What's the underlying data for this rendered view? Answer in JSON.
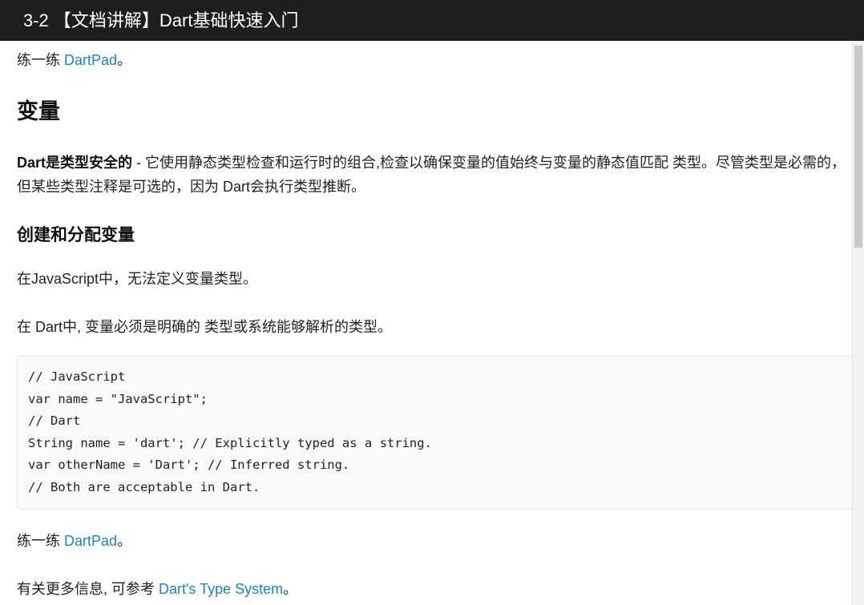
{
  "window": {
    "title": "3-2 【文档讲解】Dart基础快速入门"
  },
  "content": {
    "try_prefix": "练一练 ",
    "try_link": "DartPad",
    "try_suffix": "。",
    "h_variables": "变量",
    "type_safe_bold": "Dart是类型安全的",
    "type_safe_rest": " - 它使用静态类型检查和运行时的组合,检查以确保变量的值始终与变量的静态值匹配 类型。尽管类型是必需的，但某些类型注释是可选的，因为 Dart会执行类型推断。",
    "h_create": "创建和分配变量",
    "js_sentence": "在JavaScript中，无法定义变量类型。",
    "dart_sentence": "在 Dart中, 变量必须是明确的 类型或系统能够解析的类型。",
    "code_lines": [
      "// JavaScript",
      "var name = \"JavaScript\";",
      "// Dart",
      "String name = 'dart'; // Explicitly typed as a string.",
      "var otherName = 'Dart'; // Inferred string.",
      "// Both are acceptable in Dart."
    ],
    "try2_prefix": "练一练 ",
    "try2_link": "DartPad",
    "try2_suffix": "。",
    "more_prefix": "有关更多信息, 可参考 ",
    "more_link": "Dart's Type System",
    "more_suffix": "。"
  },
  "colors": {
    "titlebar_bg": "#1e1e1e",
    "link": "#1a82c9",
    "code_bg": "#f8f9fa"
  }
}
